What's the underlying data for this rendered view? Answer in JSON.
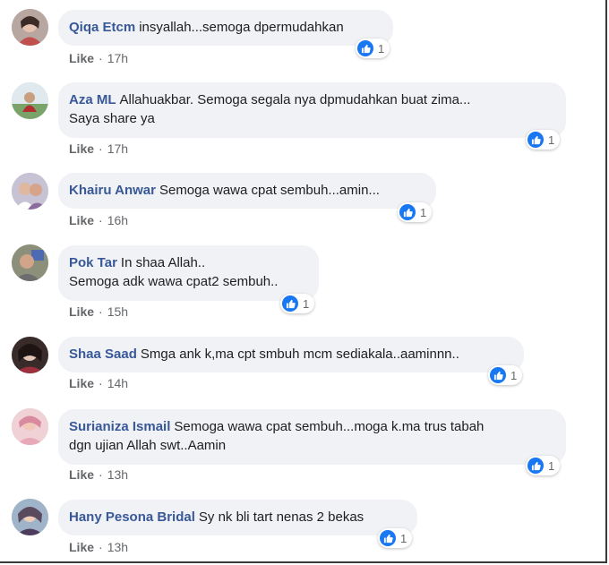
{
  "ui": {
    "like_label": "Like",
    "separator": "·"
  },
  "comments": [
    {
      "author": "Qiqa Etcm",
      "text": "insyallah...semoga dpermudahkan",
      "time": "17h",
      "reactions": "1"
    },
    {
      "author": "Aza ML",
      "text": "Allahuakbar. Semoga segala nya dpmudahkan buat zima...",
      "text2": "Saya share ya",
      "time": "17h",
      "reactions": "1"
    },
    {
      "author": "Khairu Anwar",
      "text": "Semoga wawa cpat sembuh...amin...",
      "time": "16h",
      "reactions": "1"
    },
    {
      "author": "Pok Tar",
      "text": "In shaa Allah..",
      "text2": "Semoga adk wawa cpat2 sembuh..",
      "time": "15h",
      "reactions": "1"
    },
    {
      "author": "Shaa Saad",
      "text": "Smga ank k,ma cpt smbuh mcm sediakala..aaminnn..",
      "time": "14h",
      "reactions": "1"
    },
    {
      "author": "Surianiza Ismail",
      "text": "Semoga wawa cpat sembuh...moga k.ma trus tabah",
      "text2": "dgn ujian Allah swt..Aamin",
      "time": "13h",
      "reactions": "1"
    },
    {
      "author": "Hany Pesona Bridal",
      "text": "Sy nk bli tart nenas 2 bekas",
      "time": "13h",
      "reactions": "1"
    }
  ],
  "colors": {
    "author": "#385898",
    "bubble": "#f0f2f5",
    "like_badge": "#1877f2",
    "meta": "#65676b"
  }
}
